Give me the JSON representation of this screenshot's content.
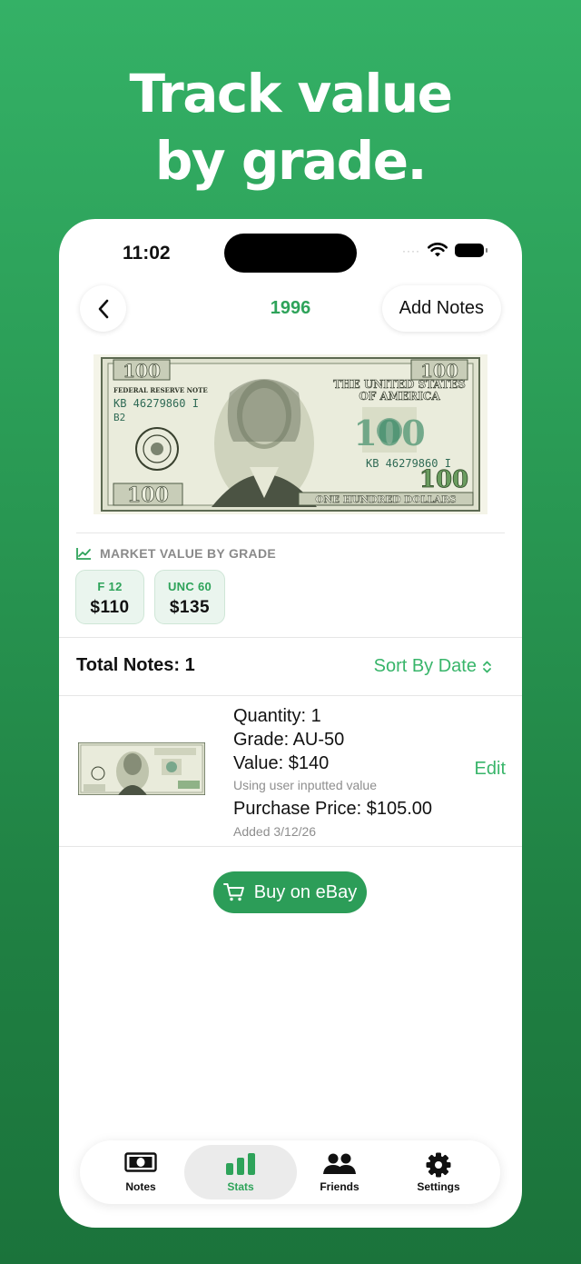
{
  "headline": {
    "line1": "Track value",
    "line2": "by grade."
  },
  "status_bar": {
    "time": "11:02",
    "signal": "····"
  },
  "nav": {
    "title": "1996",
    "add_notes_label": "Add Notes"
  },
  "banknote": {
    "federal_reserve_label": "FEDERAL RESERVE NOTE",
    "serial": "KB 46279860 I",
    "sub_code": "B2",
    "country_line1": "THE UNITED STATES",
    "country_line2": "OF AMERICA",
    "denomination": "100",
    "bottom_text": "ONE HUNDRED DOLLARS"
  },
  "market": {
    "heading": "MARKET VALUE BY GRADE",
    "grades": [
      {
        "grade": "F 12",
        "value": "$110"
      },
      {
        "grade": "UNC 60",
        "value": "$135"
      }
    ]
  },
  "list_header": {
    "total": "Total Notes: 1",
    "sort_label": "Sort By Date"
  },
  "note_item": {
    "quantity": "Quantity: 1",
    "grade": "Grade: AU-50",
    "value": "Value: $140",
    "value_note": "Using user inputted value",
    "purchase_price": "Purchase Price: $105.00",
    "added": "Added 3/12/26",
    "edit_label": "Edit"
  },
  "ebay_button": {
    "label": "Buy on eBay"
  },
  "tabs": [
    {
      "label": "Notes",
      "icon": "banknote-icon",
      "active": false
    },
    {
      "label": "Stats",
      "icon": "bar-chart-icon",
      "active": true
    },
    {
      "label": "Friends",
      "icon": "people-icon",
      "active": false
    },
    {
      "label": "Settings",
      "icon": "gear-icon",
      "active": false
    }
  ],
  "colors": {
    "accent": "#2ea35a",
    "bg_top": "#34b166",
    "bg_bottom": "#1b733b"
  }
}
